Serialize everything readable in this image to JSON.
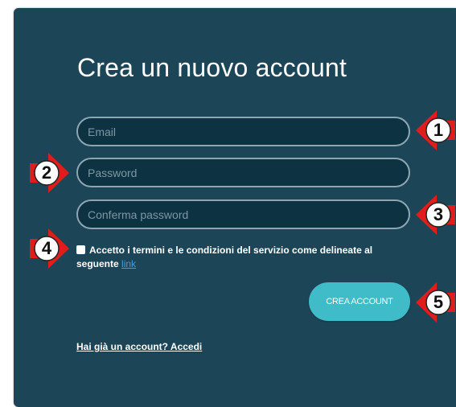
{
  "form": {
    "title": "Crea un nuovo account",
    "email_placeholder": "Email",
    "password_placeholder": "Password",
    "confirm_placeholder": "Conferma password",
    "terms_text": "Accetto i termini e le condizioni del servizio come delineate al seguente",
    "terms_link": "link",
    "submit_label": "CREA ACCOUNT",
    "login_link": "Hai già un account? Accedi"
  },
  "callouts": [
    {
      "number": "1",
      "direction": "left"
    },
    {
      "number": "2",
      "direction": "right"
    },
    {
      "number": "3",
      "direction": "left"
    },
    {
      "number": "4",
      "direction": "right"
    },
    {
      "number": "5",
      "direction": "left"
    }
  ],
  "colors": {
    "panel": "#1c4658",
    "field_bg": "#0d3242",
    "button": "#40bcc9",
    "callout_arrow": "#e01c1c",
    "link": "#4a9ad9"
  }
}
